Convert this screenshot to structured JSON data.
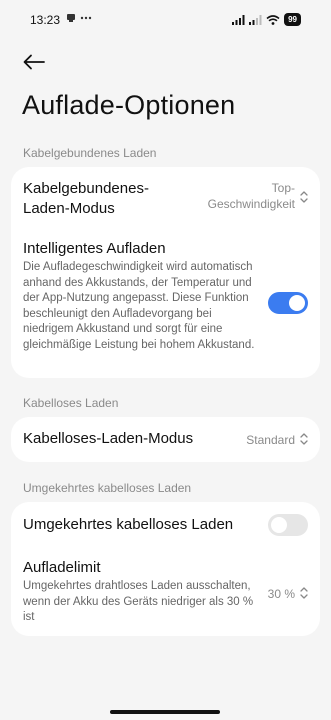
{
  "status_bar": {
    "time": "13:23",
    "battery": "99",
    "left_icons": [
      "notification-icon",
      "more-dots-icon"
    ],
    "right_icons": [
      "signal-icon",
      "signal-icon-2",
      "wifi-icon",
      "battery-icon"
    ]
  },
  "header": {
    "back_icon": "back-arrow-icon",
    "title": "Auflade-Optionen"
  },
  "sections": {
    "wired": {
      "header": "Kabelgebundenes Laden",
      "mode_title": "Kabelgebundenes-Laden-Modus",
      "mode_value": "Top-Geschwindigkeit",
      "smart_title": "Intelligentes Aufladen",
      "smart_desc": "Die Aufladegeschwindigkeit wird automatisch anhand des Akkustands, der Temperatur und der App-Nutzung angepasst. Diese Funktion beschleunigt den Aufladevorgang bei niedrigem Akkustand und sorgt für eine gleichmäßige Leistung bei hohem Akkustand.",
      "smart_enabled": true
    },
    "wireless": {
      "header": "Kabelloses Laden",
      "mode_title": "Kabelloses-Laden-Modus",
      "mode_value": "Standard"
    },
    "reverse": {
      "header": "Umgekehrtes kabelloses Laden",
      "toggle_title": "Umgekehrtes kabelloses Laden",
      "toggle_enabled": false,
      "limit_title": "Aufladelimit",
      "limit_desc": "Umgekehrtes drahtloses Laden ausschalten, wenn der Akku des Geräts niedriger als 30 % ist",
      "limit_value": "30 %"
    }
  },
  "colors": {
    "accent": "#3b7cf0",
    "background": "#f5f5f5",
    "card": "#ffffff",
    "secondary_text": "#8a8a8a"
  }
}
